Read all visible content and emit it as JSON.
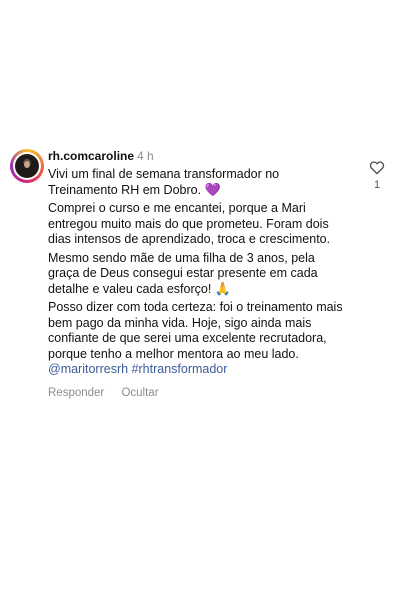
{
  "comment": {
    "username": "rh.comcaroline",
    "time": "4 h",
    "paragraphs": [
      "Vivi um final de semana transformador no Treinamento RH em Dobro.",
      "Comprei o curso e me encantei, porque a Mari entregou muito mais do que prometeu. Foram dois dias intensos de aprendizado, troca e crescimento.",
      "Mesmo sendo mãe de uma filha de 3 anos, pela graça de Deus consegui estar presente em cada detalhe e valeu cada esforço!",
      "Posso dizer com toda certeza: foi o treinamento mais bem pago da minha vida. Hoje, sigo ainda mais confiante de que serei uma excelente recrutadora, porque tenho a melhor mentora ao meu lado."
    ],
    "emojis": {
      "heart": "💜",
      "pray": "🙏"
    },
    "mention": "@maritorresrh",
    "hashtag": "#rhtransformador",
    "actions": {
      "reply": "Responder",
      "hide": "Ocultar"
    },
    "likes": "1"
  },
  "icons": {
    "avatar": "avatar",
    "like": "heart-outline-icon"
  }
}
